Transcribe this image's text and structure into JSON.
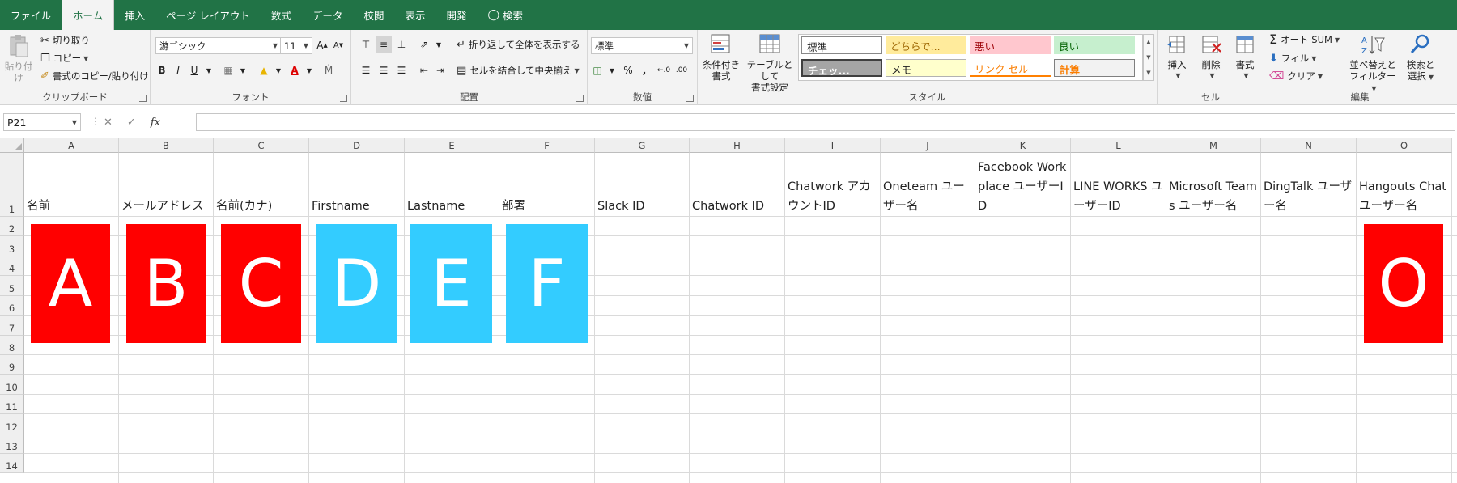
{
  "tabs": [
    "ファイル",
    "ホーム",
    "挿入",
    "ページ レイアウト",
    "数式",
    "データ",
    "校閲",
    "表示",
    "開発"
  ],
  "tell_me": "検索",
  "clipboard": {
    "paste": "貼り付け",
    "cut": "切り取り",
    "copy": "コピー",
    "format_painter": "書式のコピー/貼り付け",
    "label": "クリップボード"
  },
  "font": {
    "name": "游ゴシック",
    "size": "11",
    "label": "フォント"
  },
  "alignment": {
    "wrap": "折り返して全体を表示する",
    "merge": "セルを結合して中央揃え",
    "label": "配置"
  },
  "number": {
    "format": "標準",
    "label": "数値"
  },
  "styles": {
    "cond_format_1": "条件付き",
    "cond_format_2": "書式",
    "table_1": "テーブルとして",
    "table_2": "書式設定",
    "cells": [
      "標準",
      "どちらで...",
      "悪い",
      "良い",
      "チェッ...",
      "メモ",
      "リンク セル",
      "計算"
    ],
    "label": "スタイル"
  },
  "cells_group": {
    "insert": "挿入",
    "delete": "削除",
    "format": "書式",
    "label": "セル"
  },
  "editing": {
    "autosum": "オート SUM",
    "fill": "フィル",
    "clear": "クリア",
    "sort_1": "並べ替えと",
    "sort_2": "フィルター",
    "find_1": "検索と",
    "find_2": "選択",
    "label": "編集"
  },
  "formula_bar": {
    "name_box": "P21",
    "formula": ""
  },
  "columns": [
    "A",
    "B",
    "C",
    "D",
    "E",
    "F",
    "G",
    "H",
    "I",
    "J",
    "K",
    "L",
    "M",
    "N",
    "O"
  ],
  "rows": [
    "1",
    "2",
    "3",
    "4",
    "5",
    "6",
    "7",
    "8",
    "9",
    "10",
    "11",
    "12",
    "13",
    "14"
  ],
  "header_cells": [
    "名前",
    "メールアドレス",
    "名前(カナ)",
    "Firstname",
    "Lastname",
    "部署",
    "Slack ID",
    "Chatwork ID",
    "Chatwork アカウントID",
    "Oneteam ユーザー名",
    "Facebook Workplace ユーザーID",
    "LINE WORKS ユーザーID",
    "Microsoft Teams ユーザー名",
    "DingTalk ユーザー名",
    "Hangouts Chat ユーザー名"
  ],
  "shapes": [
    "A",
    "B",
    "C",
    "D",
    "E",
    "F",
    "O"
  ],
  "colors": {
    "accent": "#217346",
    "shape_red": "#ff0000",
    "shape_blue": "#33ccff"
  }
}
